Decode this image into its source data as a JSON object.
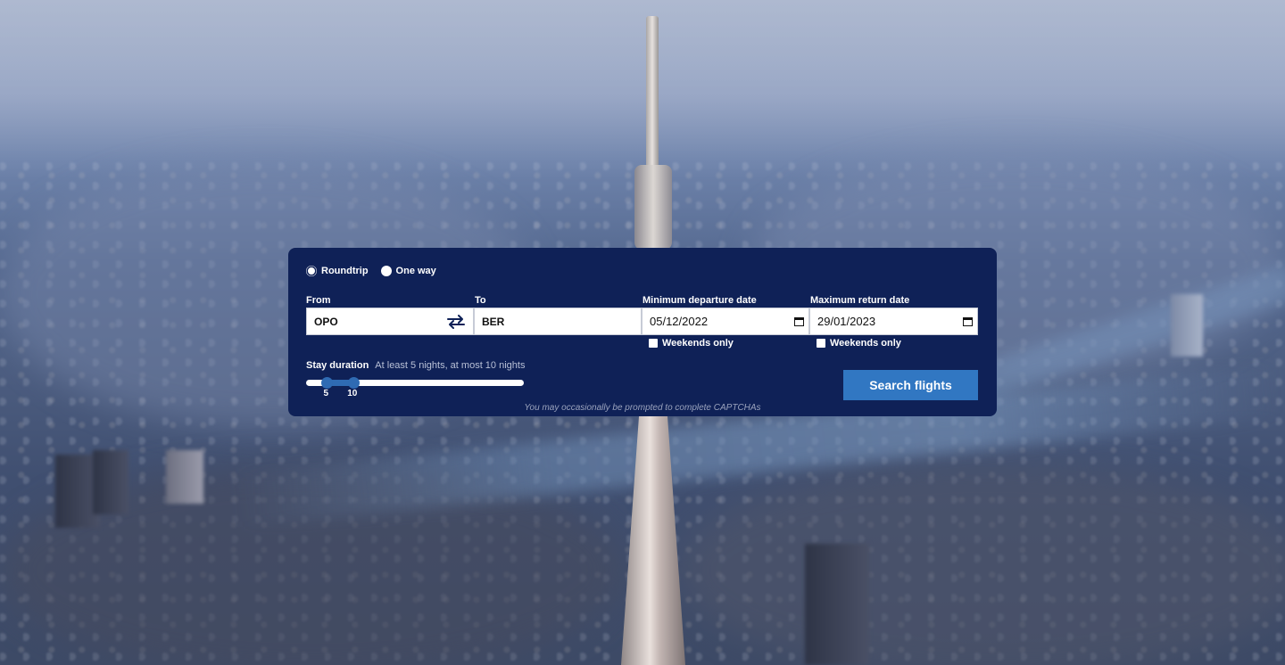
{
  "trip_type": {
    "options": [
      {
        "label": "Roundtrip",
        "selected": true
      },
      {
        "label": "One way",
        "selected": false
      }
    ]
  },
  "from": {
    "label": "From",
    "value": "OPO"
  },
  "to": {
    "label": "To",
    "value": "BER"
  },
  "departure": {
    "label": "Minimum departure date",
    "value": "05/12/2022",
    "weekends_label": "Weekends only",
    "weekends_checked": false
  },
  "return": {
    "label": "Maximum return date",
    "value": "29/01/2023",
    "weekends_label": "Weekends only",
    "weekends_checked": false
  },
  "stay": {
    "label": "Stay duration",
    "description": "At least 5 nights, at most 10 nights",
    "min": 5,
    "max": 10,
    "min_label": "5",
    "max_label": "10"
  },
  "search_button": {
    "label": "Search flights"
  },
  "captcha_note": "You may occasionally be prompted to complete CAPTCHAs",
  "colors": {
    "card": "#0f2157",
    "accent": "#3177c2"
  },
  "icons": [
    "swap-icon",
    "calendar-icon"
  ]
}
